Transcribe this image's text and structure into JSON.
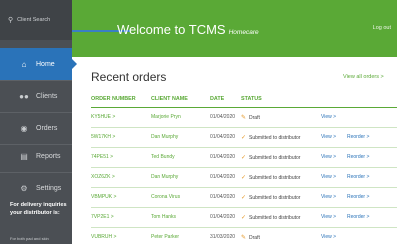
{
  "sidebar": {
    "search_placeholder": "Client Search",
    "items": [
      {
        "label": "Home",
        "icon": "home-icon"
      },
      {
        "label": "Clients",
        "icon": "users-icon"
      },
      {
        "label": "Orders",
        "icon": "orders-icon"
      },
      {
        "label": "Reports",
        "icon": "reports-icon"
      },
      {
        "label": "Settings",
        "icon": "gear-icon"
      }
    ],
    "help_text": "For delivery inquiries your distributor is:",
    "help_small": "For both pad and skin"
  },
  "header": {
    "title": "Welcome to TCMS",
    "subtitle": "Homecare",
    "logout": "Log out"
  },
  "main": {
    "title": "Recent orders",
    "view_all": "View all orders >",
    "columns": [
      "ORDER NUMBER",
      "CLIENT NAME",
      "DATE",
      "STATUS"
    ],
    "rows": [
      {
        "order": "KY5HUE >",
        "client": "Marjorie Pryn",
        "date": "01/04/2020",
        "status": "Draft",
        "status_type": "draft",
        "view": "View >",
        "reorder": ""
      },
      {
        "order": "5W17KH >",
        "client": "Dan Murphy",
        "date": "01/04/2020",
        "status": "Submitted to distributor",
        "status_type": "submitted",
        "view": "View >",
        "reorder": "Reorder >"
      },
      {
        "order": "74PE51 >",
        "client": "Ted Bundy",
        "date": "01/04/2020",
        "status": "Submitted to distributor",
        "status_type": "submitted",
        "view": "View >",
        "reorder": "Reorder >"
      },
      {
        "order": "XOZ6ZK >",
        "client": "Dan Murphy",
        "date": "01/04/2020",
        "status": "Submitted to distributor",
        "status_type": "submitted",
        "view": "View >",
        "reorder": "Reorder >"
      },
      {
        "order": "VBMPUK >",
        "client": "Corona Virus",
        "date": "01/04/2020",
        "status": "Submitted to distributor",
        "status_type": "submitted",
        "view": "View >",
        "reorder": "Reorder >"
      },
      {
        "order": "7VP2E1 >",
        "client": "Tom Hanks",
        "date": "01/04/2020",
        "status": "Submitted to distributor",
        "status_type": "submitted",
        "view": "View >",
        "reorder": "Reorder >"
      },
      {
        "order": "VUBRUH >",
        "client": "Peter Parker",
        "date": "31/03/2020",
        "status": "Draft",
        "status_type": "draft",
        "view": "View >",
        "reorder": ""
      }
    ]
  },
  "colors": {
    "brand_green": "#5aa936",
    "sidebar_bg": "#4b4f54",
    "active_blue": "#2a73b9"
  }
}
